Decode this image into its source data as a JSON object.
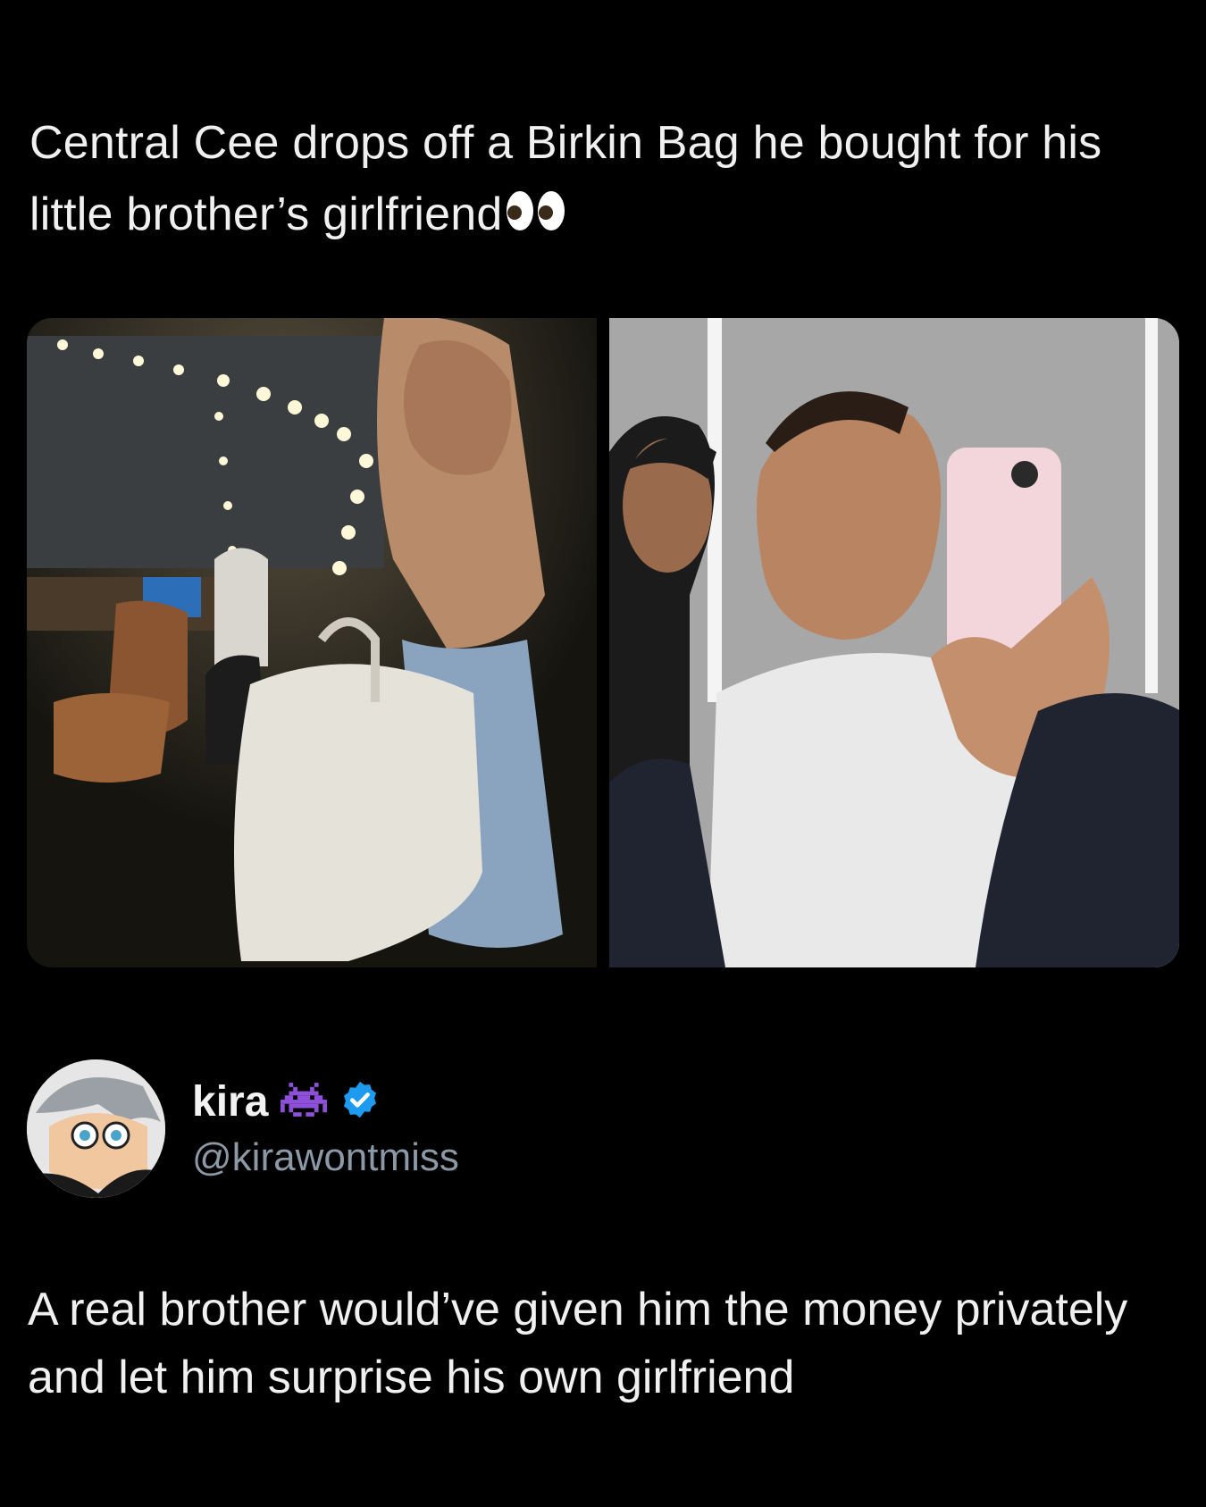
{
  "quoted_post": {
    "text": "Central Cee drops off a Birkin Bag he bought for his little brother’s girlfriend",
    "emoji": "eyes-emoji"
  },
  "media": {
    "left_image": "photo-dressing-room-woman-with-bag",
    "right_image": "photo-mirror-selfie-woman-with-phone"
  },
  "author": {
    "display_name": "kira",
    "handle": "@kirawontmiss",
    "badges": [
      "space-invader-emoji",
      "verified-badge-icon"
    ],
    "accent_color": "#1d9bf0",
    "badge_color": "#8e4fd9"
  },
  "reply": {
    "text": "A real brother would’ve given him the money privately and let him surprise his own girlfriend"
  }
}
